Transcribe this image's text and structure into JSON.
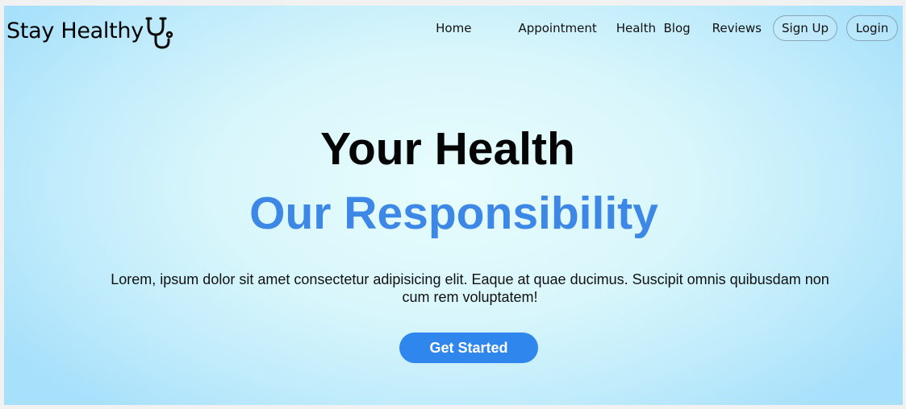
{
  "brand": {
    "name": "Stay Healthy",
    "icon": "stethoscope-icon"
  },
  "nav": {
    "items": [
      {
        "label": "Home"
      },
      {
        "label": "Appointment"
      },
      {
        "label": "Health  Blog"
      },
      {
        "label": "Reviews"
      }
    ],
    "signup_label": "Sign Up",
    "login_label": "Login"
  },
  "hero": {
    "line1": "Your Health",
    "line2": "Our Responsibility",
    "description": "Lorem, ipsum dolor sit amet consectetur adipisicing elit. Eaque at quae ducimus. Suscipit omnis quibusdam non cum rem voluptatem!",
    "cta_label": "Get Started"
  },
  "colors": {
    "accent": "#3d87e6",
    "button": "#2f86ec",
    "background_center": "#e8fdfd",
    "background_edge": "#a6e0fb"
  }
}
